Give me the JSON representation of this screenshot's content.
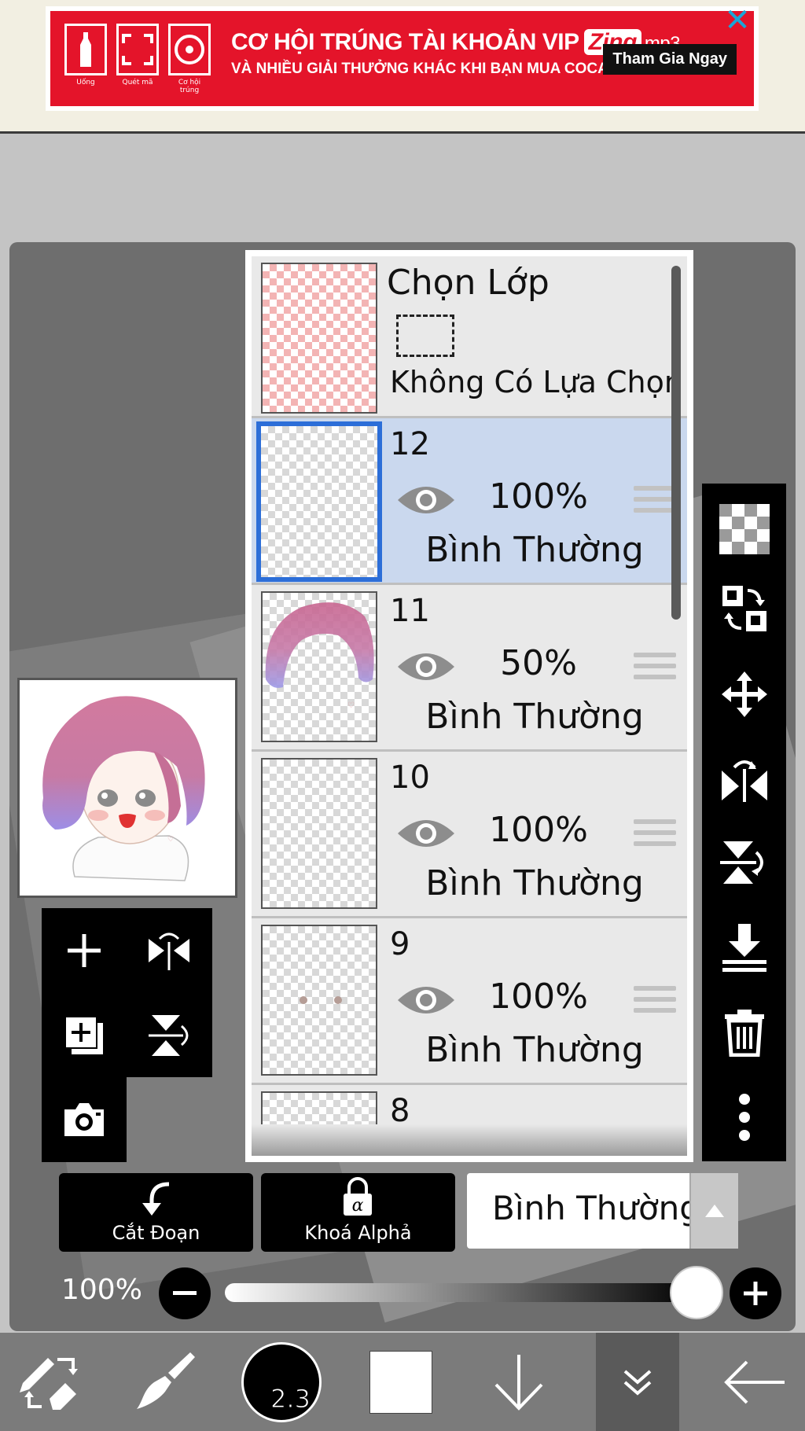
{
  "ad": {
    "headline": "CƠ HỘI TRÚNG TÀI KHOẢN VIP",
    "brand": "Zing",
    "brand_suffix": "mp3",
    "subline": "VÀ NHIỀU GIẢI THƯỞNG KHÁC KHI BẠN MUA COCA-COLA HÔM NAY",
    "cta": "Tham Gia Ngay",
    "step_labels": [
      "Uống",
      "Quét mã",
      "Cơ hội trúng"
    ],
    "close_icon": "close-icon"
  },
  "layers_panel": {
    "selection_row": {
      "title": "Chọn Lớp",
      "status": "Không Có Lựa Chọn"
    },
    "layers": [
      {
        "number": "12",
        "opacity": "100%",
        "blend": "Bình Thường",
        "selected": true
      },
      {
        "number": "11",
        "opacity": "50%",
        "blend": "Bình Thường",
        "selected": false
      },
      {
        "number": "10",
        "opacity": "100%",
        "blend": "Bình Thường",
        "selected": false
      },
      {
        "number": "9",
        "opacity": "100%",
        "blend": "Bình Thường",
        "selected": false
      },
      {
        "number": "8",
        "opacity": "",
        "blend": "",
        "selected": false
      }
    ]
  },
  "actions": {
    "clipping_label": "Cắt Đoạn",
    "alpha_lock_label": "Khoá Alphả",
    "blend_mode_value": "Bình Thường"
  },
  "opacity_slider": {
    "label": "100%",
    "value": 1.0
  },
  "toolbar": {
    "brush_size": "2.3",
    "color": "#ffffff"
  },
  "right_tools": [
    "transparent-layer-icon",
    "swap-layer-icon",
    "move-icon",
    "flip-horizontal-icon",
    "flip-vertical-icon",
    "merge-down-icon",
    "trash-icon",
    "more-icon"
  ],
  "left_tools": [
    "add-layer-icon",
    "flip-h-icon",
    "duplicate-layer-icon",
    "flip-v-icon",
    "camera-icon"
  ],
  "colors": {
    "accent_selected": "#2c6ed8",
    "selected_row_bg": "#cad8ee",
    "ad_red": "#e4142a",
    "close_blue": "#1aa6d8"
  }
}
